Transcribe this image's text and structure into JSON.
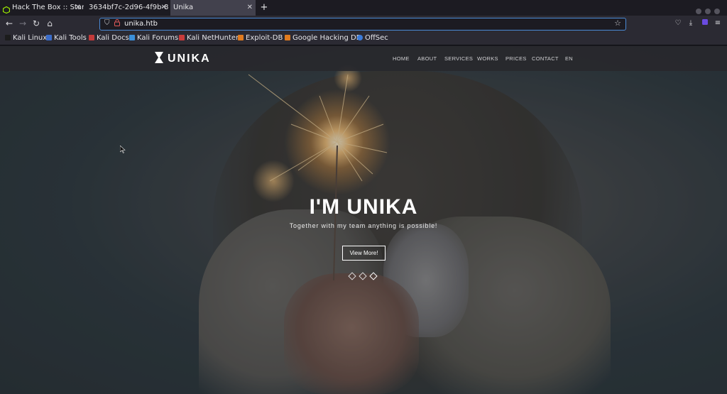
{
  "browser": {
    "tabs": [
      {
        "title": "Hack The Box :: Star",
        "active": false
      },
      {
        "title": "3634bf7c-2d96-4f9b-8",
        "active": false
      },
      {
        "title": "Unika",
        "active": true
      }
    ],
    "new_tab": "+",
    "url": "unika.htb",
    "bookmarks": [
      {
        "label": "Kali Linux",
        "color": "#1c1c1c"
      },
      {
        "label": "Kali Tools",
        "color": "#3b6cc9"
      },
      {
        "label": "Kali Docs",
        "color": "#c43a3a"
      },
      {
        "label": "Kali Forums",
        "color": "#3b8fd9"
      },
      {
        "label": "Kali NetHunter",
        "color": "#c93b3b"
      },
      {
        "label": "Exploit-DB",
        "color": "#e07b1f"
      },
      {
        "label": "Google Hacking DB",
        "color": "#e07b1f"
      },
      {
        "label": "OffSec",
        "color": "#3b7bd9"
      }
    ]
  },
  "site": {
    "logo": "UNIKA",
    "menu": [
      "HOME",
      "ABOUT",
      "SERVICES",
      "WORKS",
      "PRICES",
      "CONTACT",
      "EN"
    ],
    "hero_title": "I'M UNIKA",
    "hero_subtitle": "Together with my team anything is possible!",
    "hero_button": "View More!",
    "slider": {
      "count": 3,
      "active_index": 2
    }
  }
}
